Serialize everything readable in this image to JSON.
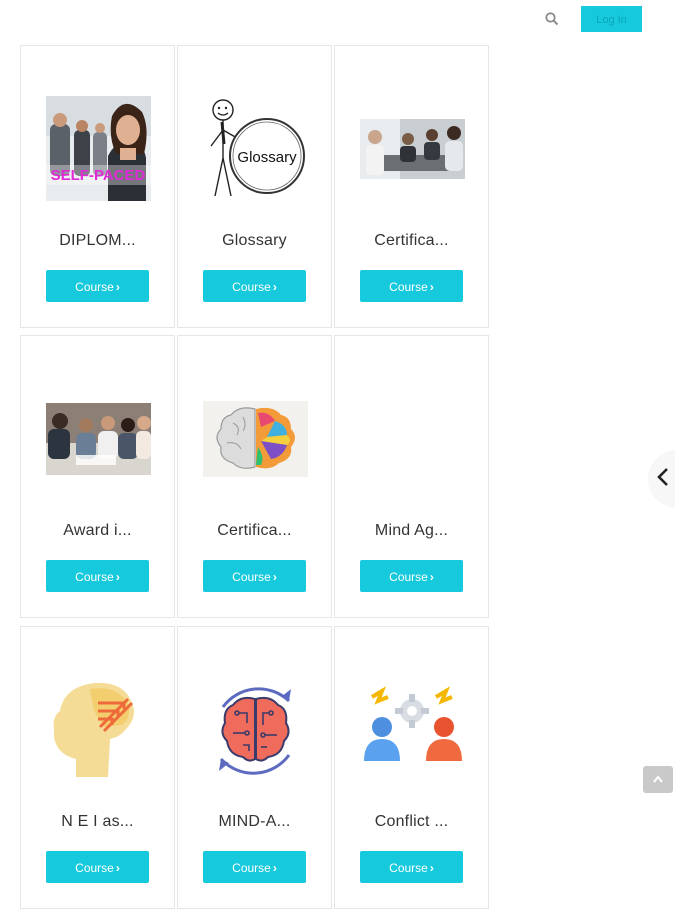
{
  "header": {
    "login_label": "Log In",
    "search_icon": "search-icon"
  },
  "courses": [
    {
      "title": "DIPLOM...",
      "button": "Course",
      "image": "self-paced-business-people-photo",
      "image_text": "SELF-PACED"
    },
    {
      "title": "Glossary",
      "button": "Course",
      "image": "glossary-stick-figure-illustration",
      "image_text": "Glossary"
    },
    {
      "title": "Certifica...",
      "button": "Course",
      "image": "meeting-table-photo"
    },
    {
      "title": "Award i...",
      "button": "Course",
      "image": "team-working-photo"
    },
    {
      "title": "Certifica...",
      "button": "Course",
      "image": "colorful-brain-illustration"
    },
    {
      "title": "Mind Ag...",
      "button": "Course",
      "image": "none"
    },
    {
      "title": "N E I as...",
      "button": "Course",
      "image": "head-profile-icon"
    },
    {
      "title": "MIND-A...",
      "button": "Course",
      "image": "brain-cycle-icon"
    },
    {
      "title": "Conflict ...",
      "button": "Course",
      "image": "conflict-people-gear-icon"
    }
  ],
  "colors": {
    "accent": "#17c9dc",
    "card_border": "#e6e6e6",
    "text": "#333333"
  }
}
